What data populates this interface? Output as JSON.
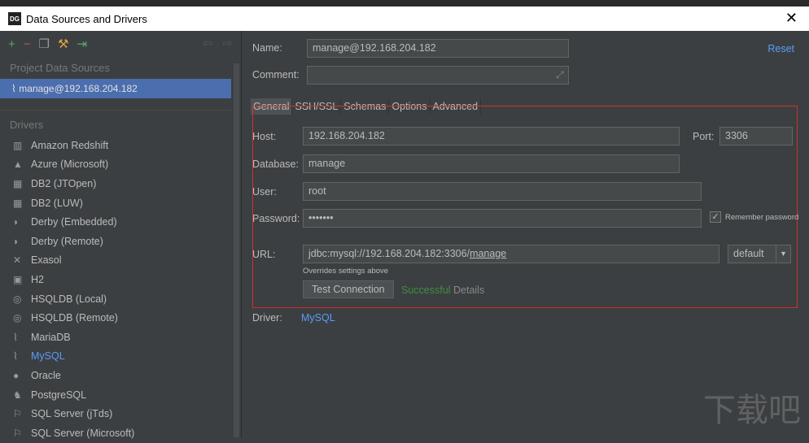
{
  "window": {
    "title": "Data Sources and Drivers",
    "logo": "DG"
  },
  "sidebar": {
    "project_header": "Project Data Sources",
    "selected": "manage@192.168.204.182",
    "drivers_header": "Drivers",
    "drivers": [
      {
        "icon": "▥",
        "label": "Amazon Redshift"
      },
      {
        "icon": "▲",
        "label": "Azure (Microsoft)"
      },
      {
        "icon": "▦",
        "label": "DB2 (JTOpen)"
      },
      {
        "icon": "▦",
        "label": "DB2 (LUW)"
      },
      {
        "icon": "◗",
        "label": "Derby (Embedded)"
      },
      {
        "icon": "◗",
        "label": "Derby (Remote)"
      },
      {
        "icon": "✕",
        "label": "Exasol"
      },
      {
        "icon": "▣",
        "label": "H2"
      },
      {
        "icon": "◎",
        "label": "HSQLDB (Local)"
      },
      {
        "icon": "◎",
        "label": "HSQLDB (Remote)"
      },
      {
        "icon": "⌇",
        "label": "MariaDB"
      },
      {
        "icon": "⌇",
        "label": "MySQL"
      },
      {
        "icon": "●",
        "label": "Oracle"
      },
      {
        "icon": "♞",
        "label": "PostgreSQL"
      },
      {
        "icon": "⚐",
        "label": "SQL Server (jTds)"
      },
      {
        "icon": "⚐",
        "label": "SQL Server (Microsoft)"
      }
    ]
  },
  "form": {
    "name_label": "Name:",
    "name": "manage@192.168.204.182",
    "comment_label": "Comment:",
    "comment": "",
    "reset": "Reset",
    "tabs": [
      "General",
      "SSH/SSL",
      "Schemas",
      "Options",
      "Advanced"
    ],
    "host_label": "Host:",
    "host": "192.168.204.182",
    "port_label": "Port:",
    "port": "3306",
    "database_label": "Database:",
    "database": "manage",
    "user_label": "User:",
    "user": "root",
    "password_label": "Password:",
    "password": "•••••••",
    "remember": "Remember password",
    "url_label": "URL:",
    "url_prefix": "jdbc:mysql://192.168.204.182:3306/",
    "url_db": "manage",
    "url_mode": "default",
    "overrides": "Overrides settings above",
    "test": "Test Connection",
    "status": "Successful",
    "details": "Details",
    "driver_label": "Driver:",
    "driver": "MySQL"
  },
  "watermark": "下载吧"
}
